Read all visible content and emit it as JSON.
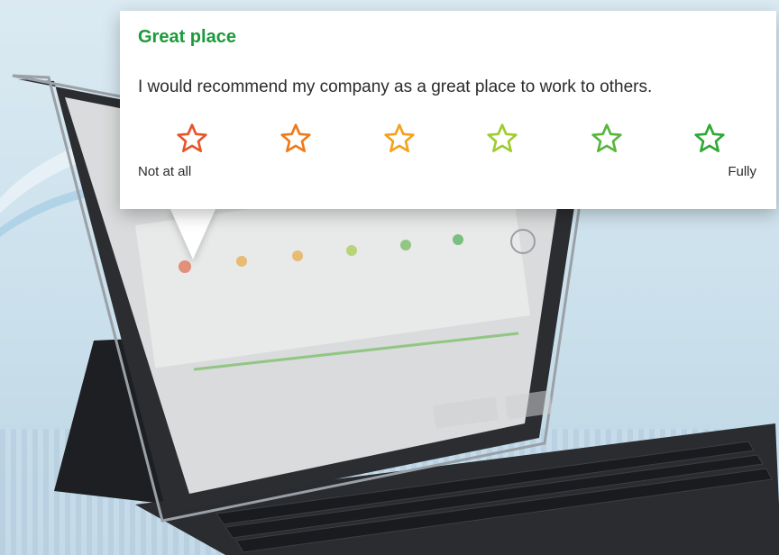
{
  "question_card": {
    "title": "Great place",
    "question": "I would recommend my company as a great place to work to others.",
    "scale_low_label": "Not at all",
    "scale_high_label": "Fully",
    "rating_options": [
      {
        "icon": "star-outline-icon",
        "color": "#e8542a"
      },
      {
        "icon": "star-outline-icon",
        "color": "#f07a1a"
      },
      {
        "icon": "star-outline-icon",
        "color": "#f4a21b"
      },
      {
        "icon": "star-outline-icon",
        "color": "#9fcc2e"
      },
      {
        "icon": "star-outline-icon",
        "color": "#57b63c"
      },
      {
        "icon": "star-outline-icon",
        "color": "#2ea934"
      }
    ]
  },
  "colors": {
    "title_accent": "#1a9a3a",
    "card_background": "#ffffff"
  }
}
